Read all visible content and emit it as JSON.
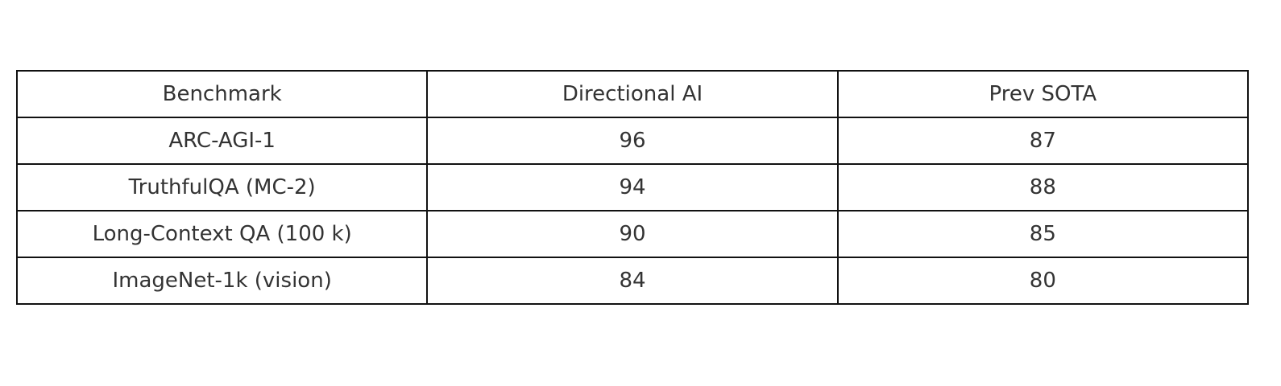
{
  "chart_data": {
    "type": "table",
    "columns": [
      "Benchmark",
      "Directional AI",
      "Prev SOTA"
    ],
    "rows": [
      [
        "ARC-AGI-1",
        "96",
        "87"
      ],
      [
        "TruthfulQA (MC-2)",
        "94",
        "88"
      ],
      [
        "Long-Context QA (100 k)",
        "90",
        "85"
      ],
      [
        "ImageNet-1k (vision)",
        "84",
        "80"
      ]
    ],
    "colors": {
      "border": "#111111",
      "text": "#333333",
      "background": "#ffffff"
    }
  }
}
